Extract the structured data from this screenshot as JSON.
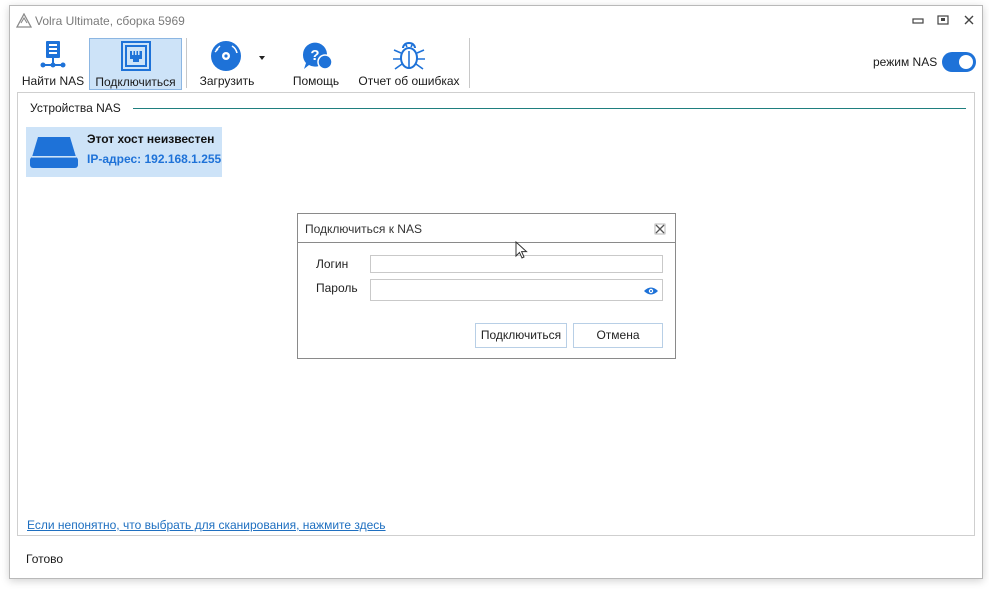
{
  "window": {
    "title": "Volra Ultimate, сборка 5969"
  },
  "toolbar": {
    "find_nas": "Найти NAS",
    "connect": "Подключиться",
    "load": "Загрузить",
    "help": "Помощь",
    "error_report": "Отчет об ошибках",
    "nas_mode_label": "режим NAS",
    "nas_mode_on": true
  },
  "devices": {
    "group_title": "Устройства NAS",
    "items": [
      {
        "name": "Этот хост неизвестен",
        "ip": "IP-адрес: 192.168.1.255"
      }
    ]
  },
  "help_link": "Если непонятно, что выбрать для сканирования, нажмите здесь",
  "status": "Готово",
  "dialog": {
    "title": "Подключиться к NAS",
    "login_label": "Логин",
    "login_value": "",
    "password_label": "Пароль",
    "password_value": "",
    "connect_button": "Подключиться",
    "cancel_button": "Отмена"
  },
  "colors": {
    "accent": "#1e72d8",
    "selection": "#cde3f8",
    "group_line": "#1f7f7f"
  }
}
